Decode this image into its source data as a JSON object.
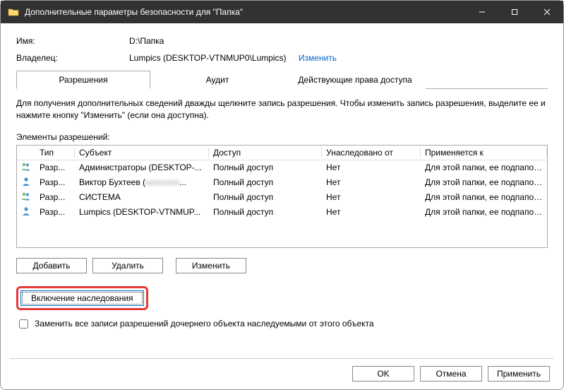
{
  "window": {
    "title": "Дополнительные параметры безопасности для \"Папка\""
  },
  "info": {
    "name_label": "Имя:",
    "name_value": "D:\\Папка",
    "owner_label": "Владелец:",
    "owner_value": "Lumpics (DESKTOP-VTNMUP0\\Lumpics)",
    "change_link": "Изменить"
  },
  "tabs": {
    "permissions": "Разрешения",
    "audit": "Аудит",
    "effective": "Действующие права доступа"
  },
  "instructions": "Для получения дополнительных сведений дважды щелкните запись разрешения. Чтобы изменить запись разрешения, выделите ее и нажмите кнопку \"Изменить\" (если она доступна).",
  "elements_label": "Элементы разрешений:",
  "perm_table": {
    "headers": {
      "type": "Тип",
      "subject": "Субъект",
      "access": "Доступ",
      "inherited": "Унаследовано от",
      "applies": "Применяется к"
    },
    "rows": [
      {
        "icon": "group",
        "type": "Разр...",
        "subject": "Администраторы (DESKTOP-...",
        "access": "Полный доступ",
        "inherited": "Нет",
        "applies": "Для этой папки, ее подпапок ..."
      },
      {
        "icon": "user",
        "type": "Разр...",
        "subject": "Виктор Бухтеев (",
        "subject_blur": "xxxxxxxx",
        "subject_tail": "...",
        "access": "Полный доступ",
        "inherited": "Нет",
        "applies": "Для этой папки, ее подпапок ..."
      },
      {
        "icon": "group",
        "type": "Разр...",
        "subject": "СИСТЕМА",
        "access": "Полный доступ",
        "inherited": "Нет",
        "applies": "Для этой папки, ее подпапок ..."
      },
      {
        "icon": "user",
        "type": "Разр...",
        "subject": "Lumpics (DESKTOP-VTNMUP...",
        "access": "Полный доступ",
        "inherited": "Нет",
        "applies": "Для этой папки, ее подпапок ..."
      }
    ]
  },
  "buttons": {
    "add": "Добавить",
    "remove": "Удалить",
    "edit": "Изменить",
    "enable_inherit": "Включение наследования",
    "ok": "OK",
    "cancel": "Отмена",
    "apply": "Применить"
  },
  "checkbox": {
    "label": "Заменить все записи разрешений дочернего объекта наследуемыми от этого объекта"
  }
}
